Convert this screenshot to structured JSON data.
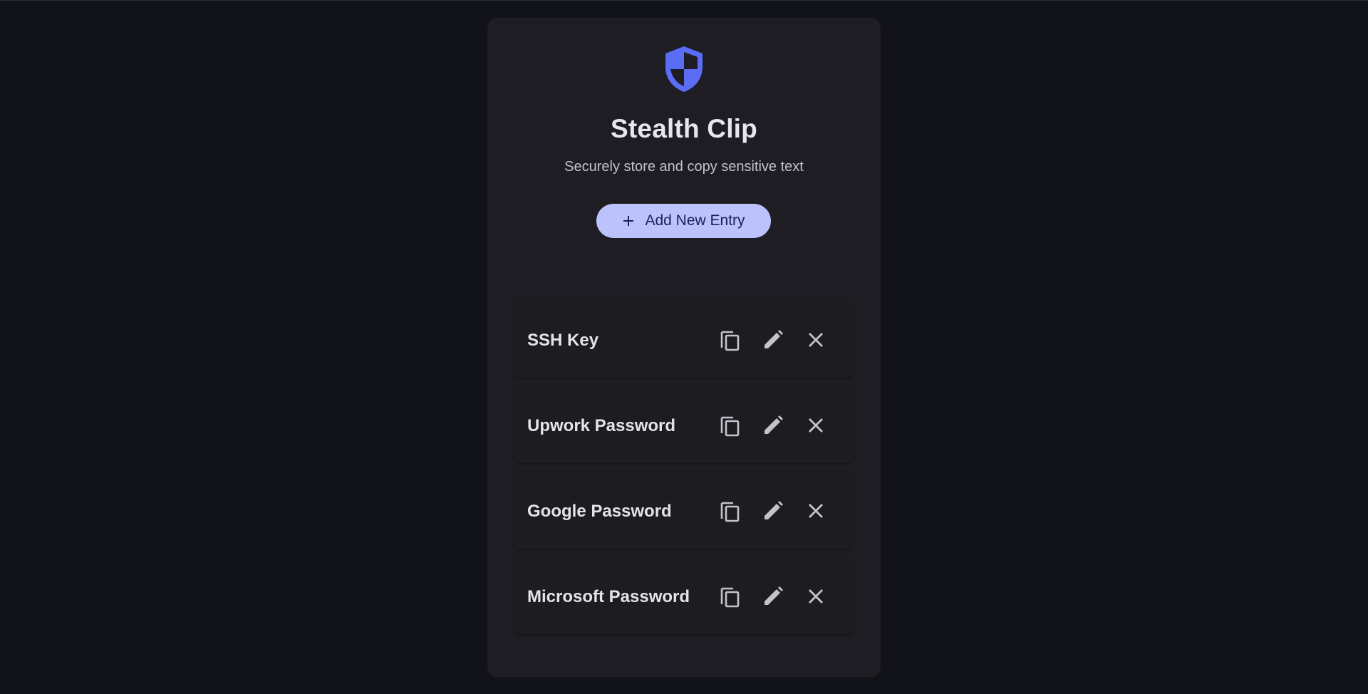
{
  "app": {
    "title": "Stealth Clip",
    "subtitle": "Securely store and copy sensitive text",
    "logo_icon": "shield-icon",
    "accent_color": "#5b6cf5"
  },
  "toolbar": {
    "add_label": "Add New Entry",
    "add_icon": "plus-icon",
    "add_bg": "#bcc2fb"
  },
  "entries": [
    {
      "label": "SSH Key"
    },
    {
      "label": "Upwork Password"
    },
    {
      "label": "Google Password"
    },
    {
      "label": "Microsoft Password"
    }
  ],
  "entry_actions": [
    "copy-icon",
    "edit-icon",
    "close-icon"
  ]
}
